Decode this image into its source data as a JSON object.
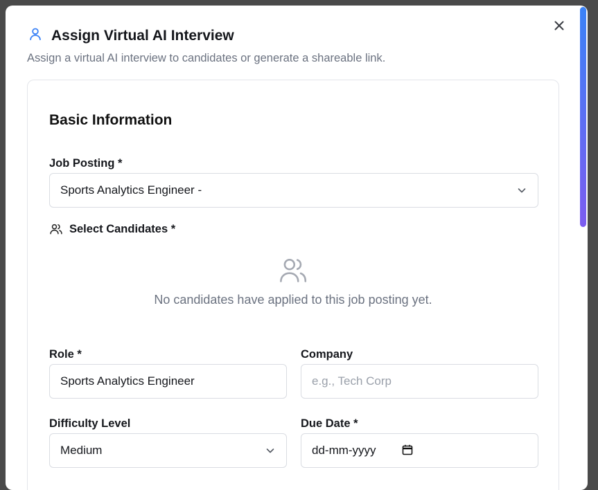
{
  "dialog": {
    "title": "Assign Virtual AI Interview",
    "subtitle": "Assign a virtual AI interview to candidates or generate a shareable link."
  },
  "section": {
    "title": "Basic Information"
  },
  "job_posting": {
    "label": "Job Posting *",
    "value": "Sports Analytics Engineer -"
  },
  "candidates": {
    "label": "Select Candidates *",
    "empty_message": "No candidates have applied to this job posting yet."
  },
  "role": {
    "label": "Role *",
    "value": "Sports Analytics Engineer"
  },
  "company": {
    "label": "Company",
    "placeholder": "e.g., Tech Corp"
  },
  "difficulty": {
    "label": "Difficulty Level",
    "value": "Medium"
  },
  "due_date": {
    "label": "Due Date *",
    "placeholder": "dd-mm-yyyy"
  },
  "colors": {
    "accent": "#3b82f6",
    "scroll_gradient_end": "#7c5cf0"
  },
  "icons": {
    "title": "user-icon",
    "close": "close-icon",
    "candidates": "users-icon",
    "dropdown": "chevron-down-icon",
    "calendar": "calendar-icon"
  }
}
